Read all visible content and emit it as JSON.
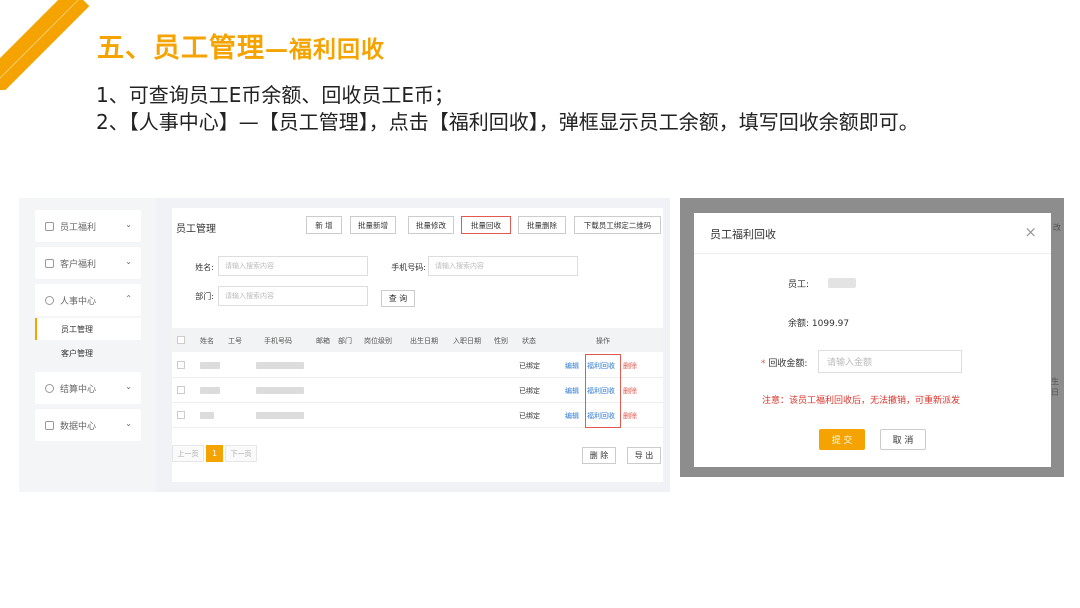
{
  "slide": {
    "title": "五、员工管理",
    "title_sub": "—福利回收",
    "bullets": [
      "1、可查询员工E币余额、回收员工E币；",
      "2、【人事中心】—【员工管理】，点击【福利回收】，弹框显示员工余额，填写回收余额即可。"
    ],
    "accent_color": "#f5a300"
  },
  "sidebar": {
    "groups": [
      {
        "label": "员工福利",
        "icon": "gift-icon",
        "chevron": "⌄"
      },
      {
        "label": "客户福利",
        "icon": "gift-icon",
        "chevron": "⌄"
      },
      {
        "label": "人事中心",
        "icon": "user-icon",
        "chevron": "⌃"
      },
      {
        "label": "结算中心",
        "icon": "coin-icon",
        "chevron": "⌄"
      },
      {
        "label": "数据中心",
        "icon": "chart-icon",
        "chevron": "⌄"
      }
    ],
    "subitems": [
      "员工管理",
      "客户管理"
    ]
  },
  "page": {
    "title": "员工管理",
    "toolbar": [
      "新 增",
      "批量新增",
      "批量修改",
      "批量回收",
      "批量删除",
      "下载员工绑定二维码"
    ],
    "search": {
      "name_label": "姓名:",
      "name_placeholder": "请输入搜索内容",
      "phone_label": "手机号码:",
      "phone_placeholder": "请输入搜索内容",
      "dept_label": "部门:",
      "dept_placeholder": "请输入搜索内容",
      "query_button": "查 询"
    },
    "table": {
      "headers": [
        "姓名",
        "工号",
        "手机号码",
        "邮箱",
        "部门",
        "岗位级别",
        "出生日期",
        "入职日期",
        "性别",
        "状态",
        "操作"
      ],
      "rows": [
        {
          "status": "已绑定",
          "edit": "编辑",
          "recycle": "福利回收",
          "delete": "删除"
        },
        {
          "status": "已绑定",
          "edit": "编辑",
          "recycle": "福利回收",
          "delete": "删除"
        },
        {
          "status": "已绑定",
          "edit": "编辑",
          "recycle": "福利回收",
          "delete": "删除"
        }
      ]
    },
    "pager": {
      "prev": "上一页",
      "current": "1",
      "next": "下一页"
    },
    "footer_buttons": [
      "删 除",
      "导 出"
    ]
  },
  "modal": {
    "bg_peek_1": "改",
    "bg_peek_2": "生日",
    "title": "员工福利回收",
    "close": "×",
    "employee_label": "员工:",
    "balance_label": "余额:",
    "balance_value": "1099.97",
    "amount_required": "*",
    "amount_label": "回收金额:",
    "amount_placeholder": "请输入金额",
    "warning": "注意：该员工福利回收后，无法撤销，可重新派发",
    "submit": "提 交",
    "cancel": "取 消"
  }
}
